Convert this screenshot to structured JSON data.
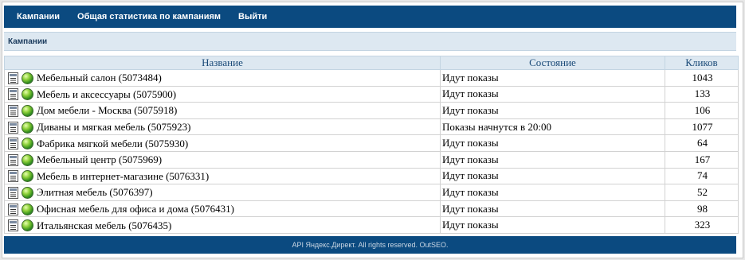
{
  "nav": {
    "items": [
      {
        "label": "Кампании"
      },
      {
        "label": "Общая статистика по кампаниям"
      },
      {
        "label": "Выйти"
      }
    ]
  },
  "section": {
    "title": "Кампании"
  },
  "table": {
    "headers": {
      "name": "Название",
      "status": "Состояние",
      "clicks": "Кликов"
    },
    "rows": [
      {
        "name": "Мебельный салон (5073484)",
        "status": "Идут показы",
        "clicks": "1043"
      },
      {
        "name": "Мебель и аксессуары (5075900)",
        "status": "Идут показы",
        "clicks": "133"
      },
      {
        "name": "Дом мебели - Москва (5075918)",
        "status": "Идут показы",
        "clicks": "106"
      },
      {
        "name": "Диваны и мягкая мебель (5075923)",
        "status": "Показы начнутся в 20:00",
        "clicks": "1077"
      },
      {
        "name": "Фабрика мягкой мебели (5075930)",
        "status": "Идут показы",
        "clicks": "64"
      },
      {
        "name": "Мебельный центр (5075969)",
        "status": "Идут показы",
        "clicks": "167"
      },
      {
        "name": "Мебель в интернет-магазине (5076331)",
        "status": "Идут показы",
        "clicks": "74"
      },
      {
        "name": "Элитная мебель (5076397)",
        "status": "Идут показы",
        "clicks": "52"
      },
      {
        "name": "Офисная мебель для офиса и дома (5076431)",
        "status": "Идут показы",
        "clicks": "98"
      },
      {
        "name": "Итальянская мебель (5076435)",
        "status": "Идут показы",
        "clicks": "323"
      }
    ]
  },
  "footer": {
    "text": "API Яндекс.Директ. All rights reserved. OutSEO."
  },
  "colors": {
    "nav_bg": "#0b4a80",
    "header_bg": "#dde8f1",
    "header_text": "#1a4a78"
  },
  "icons": {
    "row_stats": "document-stats-icon",
    "row_globe": "globe-icon"
  }
}
